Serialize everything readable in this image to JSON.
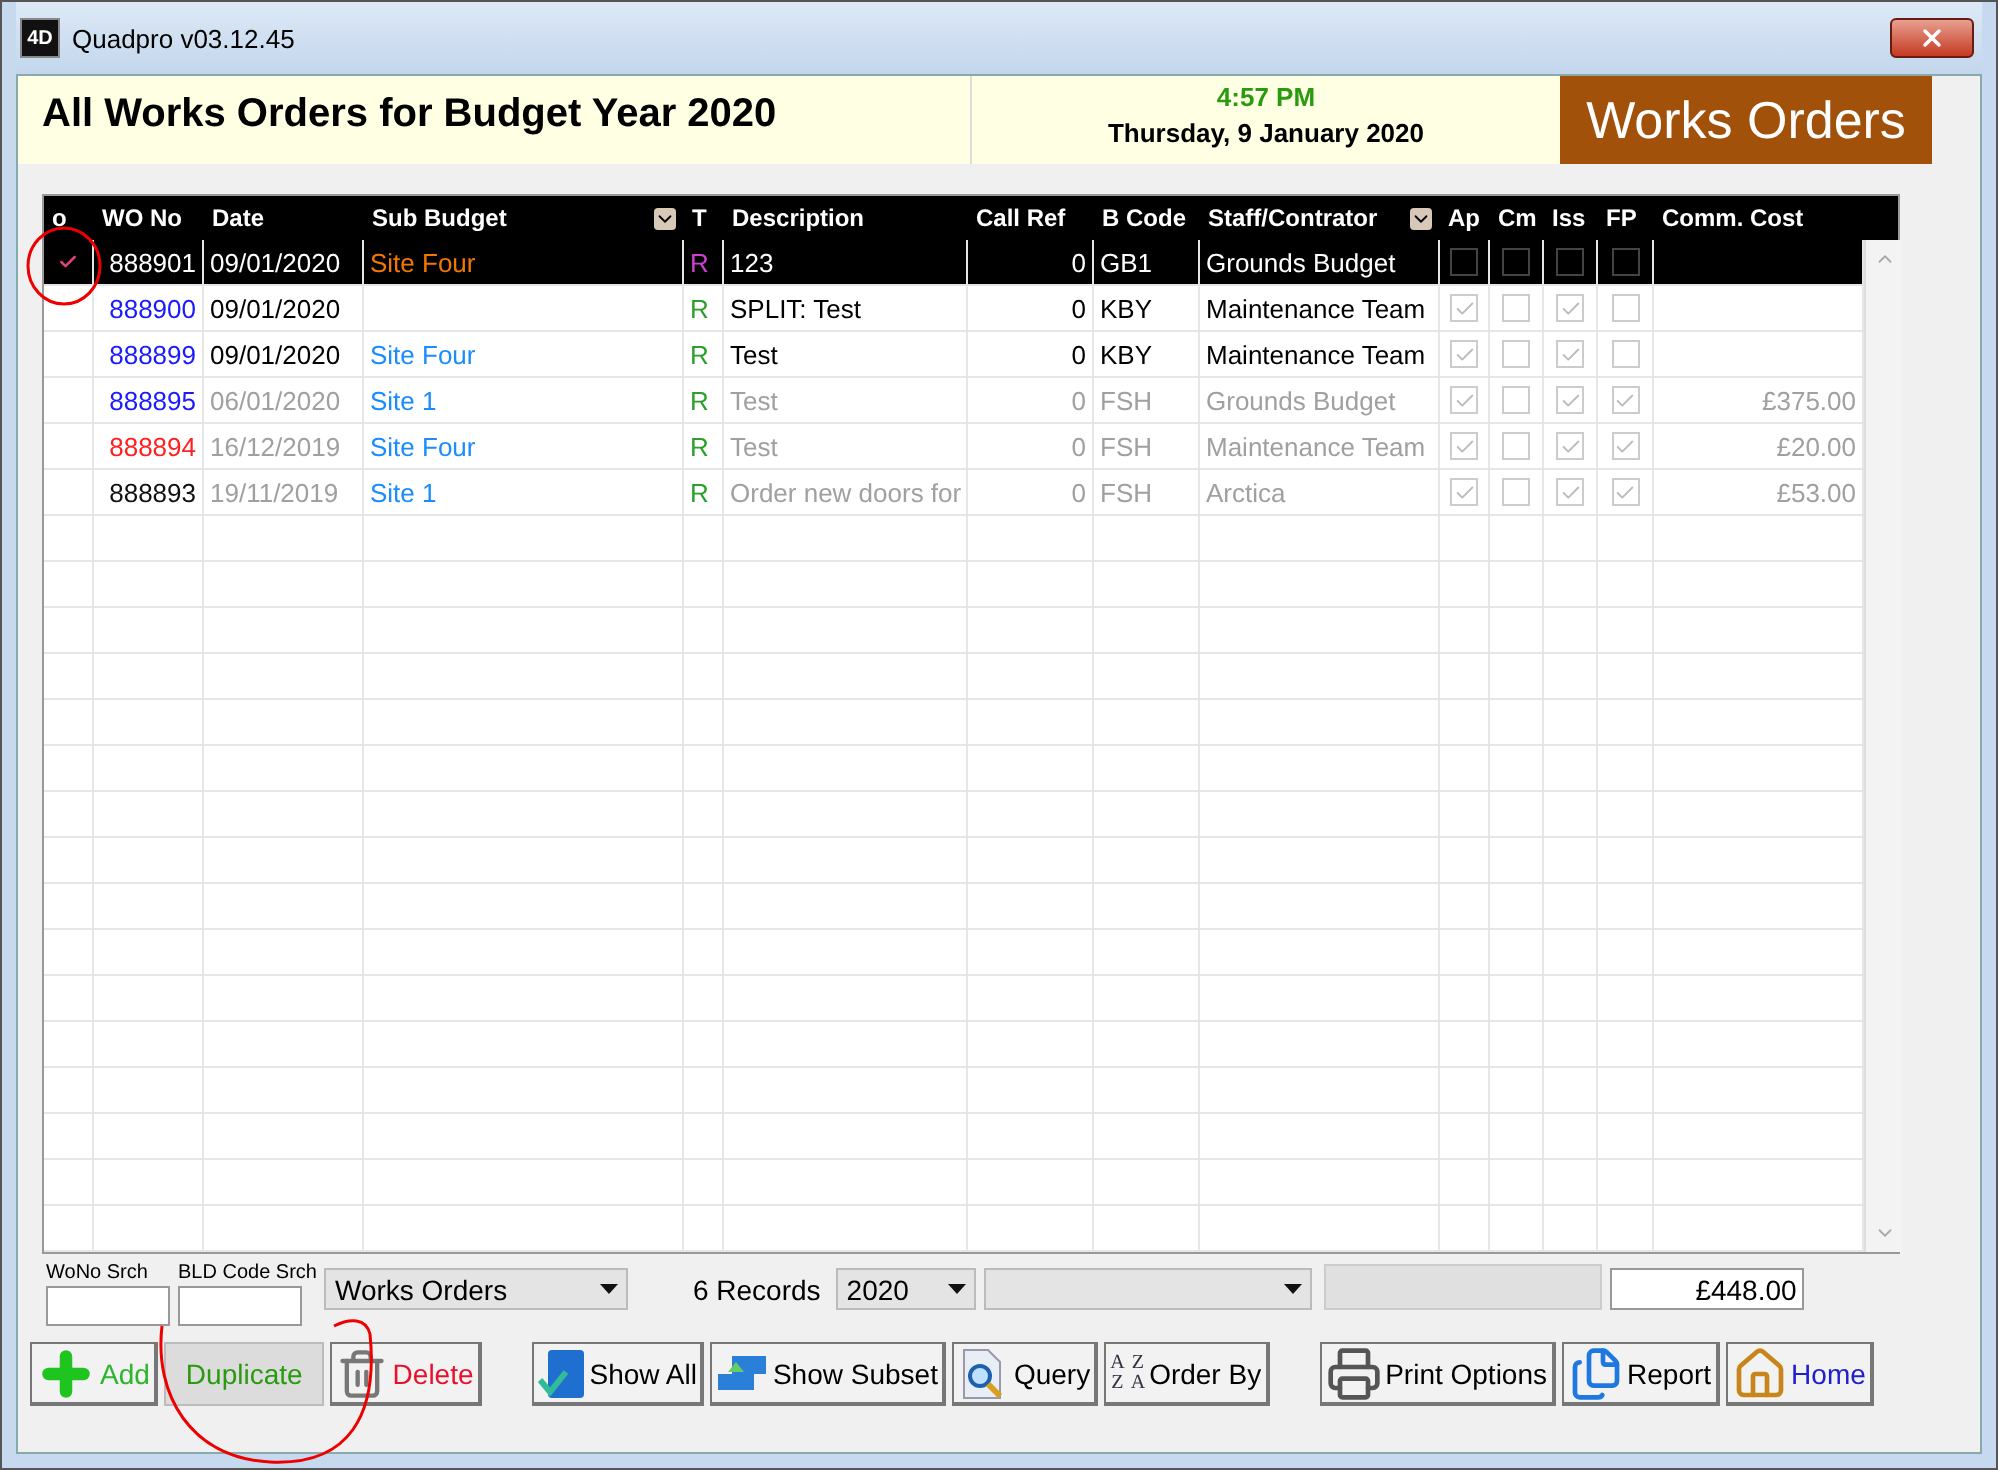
{
  "window": {
    "title": "Quadpro v03.12.45",
    "app_icon_text": "4D"
  },
  "header": {
    "title": "All Works Orders for Budget Year 2020",
    "time": "4:57 PM",
    "date": "Thursday, 9 January 2020",
    "module": "Works Orders"
  },
  "table": {
    "columns": [
      "o",
      "WO No",
      "Date",
      "Sub Budget",
      "T",
      "Description",
      "Call Ref",
      "B Code",
      "Staff/Contrator",
      "Ap",
      "Cm",
      "Iss",
      "FP",
      "Comm. Cost"
    ],
    "rows": [
      {
        "selected": true,
        "dimmed": false,
        "marked": true,
        "wo": "888901",
        "date": "09/01/2020",
        "sub_budget": "Site  Four",
        "t": "R",
        "description": "123",
        "call_ref": "0",
        "b_code": "GB1",
        "staff": "Grounds Budget",
        "ap": false,
        "cm": false,
        "iss": false,
        "fp": false,
        "cost": ""
      },
      {
        "selected": false,
        "dimmed": false,
        "marked": false,
        "color": "#1a1aff",
        "wo": "888900",
        "date": "09/01/2020",
        "sub_budget": "",
        "t": "R",
        "description": "SPLIT: Test",
        "call_ref": "0",
        "b_code": "KBY",
        "staff": "Maintenance Team",
        "ap": true,
        "cm": false,
        "iss": true,
        "fp": false,
        "cost": ""
      },
      {
        "selected": false,
        "dimmed": false,
        "marked": false,
        "color": "#1a1aff",
        "wo": "888899",
        "date": "09/01/2020",
        "sub_budget": "Site  Four",
        "t": "R",
        "description": "Test",
        "call_ref": "0",
        "b_code": "KBY",
        "staff": "Maintenance Team",
        "ap": true,
        "cm": false,
        "iss": true,
        "fp": false,
        "cost": ""
      },
      {
        "selected": false,
        "dimmed": true,
        "marked": false,
        "color": "#1a1aff",
        "wo": "888895",
        "date": "06/01/2020",
        "sub_budget": "Site 1",
        "t": "R",
        "description": "Test",
        "call_ref": "0",
        "b_code": "FSH",
        "staff": "Grounds Budget",
        "ap": true,
        "cm": false,
        "iss": true,
        "fp": true,
        "cost": "£375.00"
      },
      {
        "selected": false,
        "dimmed": true,
        "marked": false,
        "color": "#ff2020",
        "wo": "888894",
        "date": "16/12/2019",
        "sub_budget": "Site  Four",
        "t": "R",
        "description": "Test",
        "call_ref": "0",
        "b_code": "FSH",
        "staff": "Maintenance Team",
        "ap": true,
        "cm": false,
        "iss": true,
        "fp": true,
        "cost": "£20.00"
      },
      {
        "selected": false,
        "dimmed": true,
        "marked": false,
        "color": "#111111",
        "wo": "888893",
        "date": "19/11/2019",
        "sub_budget": "Site 1",
        "t": "R",
        "description": "Order new doors for",
        "call_ref": "0",
        "b_code": "FSH",
        "staff": "Arctica",
        "ap": true,
        "cm": false,
        "iss": true,
        "fp": true,
        "cost": "£53.00"
      }
    ]
  },
  "footer": {
    "wono_label": "WoNo Srch",
    "bld_label": "BLD Code Srch",
    "view_select": "Works Orders",
    "records": "6 Records",
    "year_select": "2020",
    "total": "£448.00"
  },
  "buttons": [
    {
      "kind": "add",
      "label": "Add",
      "disabled": false
    },
    {
      "kind": "duplicate",
      "label": "Duplicate",
      "disabled": true
    },
    {
      "kind": "delete",
      "label": "Delete",
      "disabled": false
    },
    {
      "kind": "showall",
      "label": "Show All",
      "disabled": false
    },
    {
      "kind": "subset",
      "label": "Show Subset",
      "disabled": false
    },
    {
      "kind": "query",
      "label": "Query",
      "disabled": false
    },
    {
      "kind": "orderby",
      "label": "Order By",
      "disabled": false,
      "icon_letters": [
        "A",
        "Z",
        "Z",
        "A"
      ]
    },
    {
      "kind": "print",
      "label": "Print Options",
      "disabled": false
    },
    {
      "kind": "report",
      "label": "Report",
      "disabled": false
    },
    {
      "kind": "home",
      "label": "Home",
      "disabled": false
    }
  ]
}
